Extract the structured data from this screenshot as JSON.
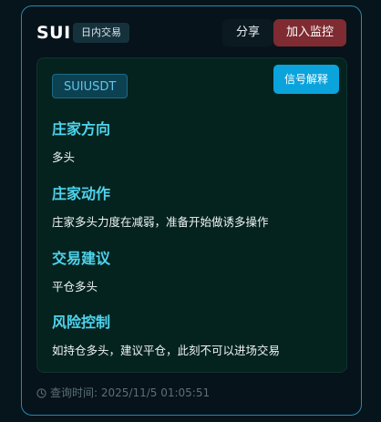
{
  "header": {
    "symbol": "SUI",
    "tag": "日内交易",
    "share_label": "分享",
    "watch_label": "加入监控"
  },
  "panel": {
    "ticker": "SUIUSDT",
    "explain_label": "信号解释",
    "sections": [
      {
        "title": "庄家方向",
        "text": "多头"
      },
      {
        "title": "庄家动作",
        "text": "庄家多头力度在减弱，准备开始做诱多操作"
      },
      {
        "title": "交易建议",
        "text": "平仓多头"
      },
      {
        "title": "风险控制",
        "text": "如持仓多头，建议平仓，此刻不可以进场交易"
      }
    ]
  },
  "footer": {
    "icon": "clock-icon",
    "query_time": "查询时间: 2025/11/5 01:05:51"
  },
  "colors": {
    "accent_title": "#4fd3ec",
    "watch_button": "#7e2b31",
    "explain_button": "#0ba3dc",
    "card_border": "#2a86b4"
  }
}
